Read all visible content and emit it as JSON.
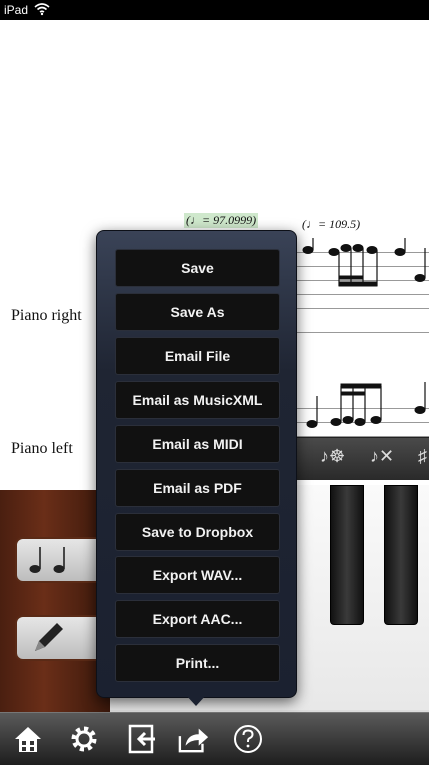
{
  "status_bar": {
    "device": "iPad",
    "wifi_icon": "wifi-icon"
  },
  "score": {
    "tempo_1": "(♩= 97.0999)",
    "tempo_2": "(♩= 109.5)",
    "instrument_1": "Piano right",
    "instrument_2": "Piano left"
  },
  "toolbar_strip": {
    "glyph_1": "♪☸",
    "glyph_2": "♪✕",
    "glyph_3": "♯"
  },
  "share_menu": {
    "items": [
      {
        "label": "Save"
      },
      {
        "label": "Save As"
      },
      {
        "label": "Email File"
      },
      {
        "label": "Email as MusicXML"
      },
      {
        "label": "Email as MIDI"
      },
      {
        "label": "Email as PDF"
      },
      {
        "label": "Save to Dropbox"
      },
      {
        "label": "Export WAV..."
      },
      {
        "label": "Export AAC..."
      },
      {
        "label": "Print..."
      }
    ]
  },
  "bottom_bar": {
    "icons": [
      "home-icon",
      "gear-icon",
      "import-icon",
      "share-icon",
      "help-icon"
    ]
  }
}
